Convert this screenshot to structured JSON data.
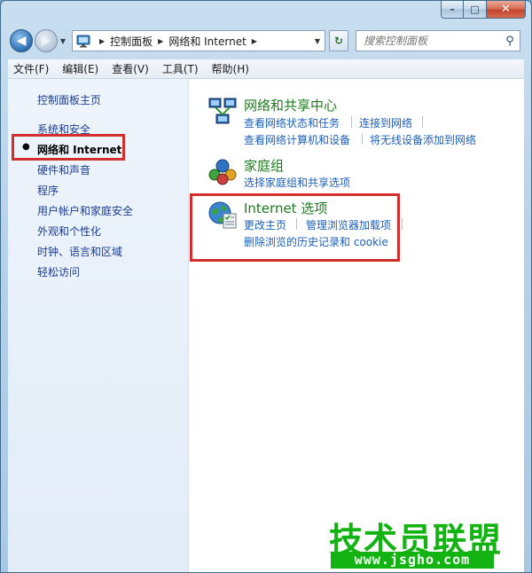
{
  "window": {
    "minimize": "–",
    "maximize": "□",
    "close": "✕"
  },
  "address": {
    "crumbs": [
      "控制面板",
      "网络和 Internet"
    ],
    "search_placeholder": "搜索控制面板"
  },
  "menu": [
    "文件(F)",
    "编辑(E)",
    "查看(V)",
    "工具(T)",
    "帮助(H)"
  ],
  "sidebar": {
    "home": "控制面板主页",
    "items": [
      "系统和安全",
      "网络和 Internet",
      "硬件和声音",
      "程序",
      "用户帐户和家庭安全",
      "外观和个性化",
      "时钟、语言和区域",
      "轻松访问"
    ],
    "active_index": 1
  },
  "categories": [
    {
      "title": "网络和共享中心",
      "links": [
        [
          "查看网络状态和任务",
          "连接到网络"
        ],
        [
          "查看网络计算机和设备",
          "将无线设备添加到网络"
        ]
      ]
    },
    {
      "title": "家庭组",
      "links": [
        [
          "选择家庭组和共享选项"
        ]
      ]
    },
    {
      "title": "Internet 选项",
      "links": [
        [
          "更改主页",
          "管理浏览器加载项"
        ],
        [
          "删除浏览的历史记录和 cookie"
        ]
      ]
    }
  ],
  "watermark": {
    "name": "技术员联盟",
    "url": "www.jsgho.com"
  },
  "colors": {
    "link": "#1b5fb6",
    "category_title": "#1e7a1e",
    "highlight": "#d22e2e",
    "watermark": "#12b312"
  }
}
